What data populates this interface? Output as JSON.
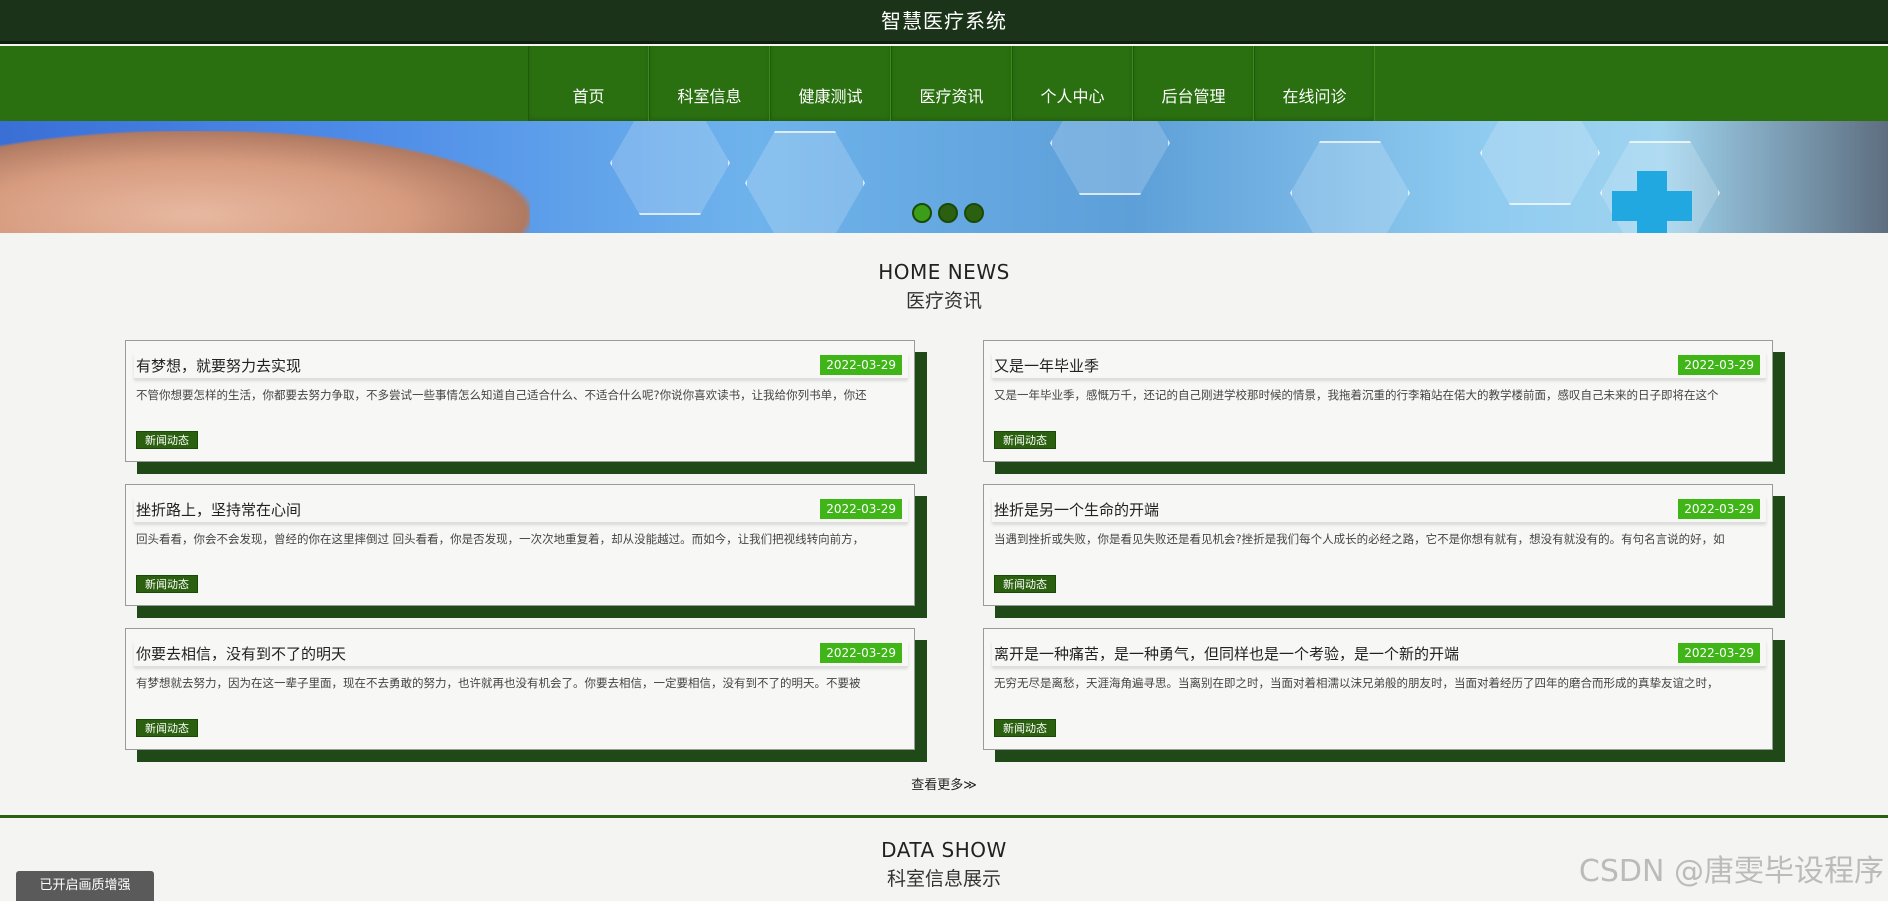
{
  "header": {
    "site_title": "智慧医疗系统"
  },
  "nav": {
    "items": [
      {
        "label": "首页"
      },
      {
        "label": "科室信息"
      },
      {
        "label": "健康测试"
      },
      {
        "label": "医疗资讯"
      },
      {
        "label": "个人中心"
      },
      {
        "label": "后台管理"
      },
      {
        "label": "在线问诊"
      }
    ]
  },
  "banner": {
    "slides_total": 3,
    "active_slide": 1
  },
  "news_section": {
    "heading_en": "HOME NEWS",
    "heading_zh": "医疗资讯",
    "items": [
      {
        "title": "有梦想，就要努力去实现",
        "date": "2022-03-29",
        "excerpt": "不管你想要怎样的生活，你都要去努力争取，不多尝试一些事情怎么知道自己适合什么、不适合什么呢?你说你喜欢读书，让我给你列书单，你还",
        "tag": "新闻动态"
      },
      {
        "title": "又是一年毕业季",
        "date": "2022-03-29",
        "excerpt": "又是一年毕业季，感慨万千，还记的自己刚进学校那时候的情景，我拖着沉重的行李箱站在偌大的教学楼前面，感叹自己未来的日子即将在这个",
        "tag": "新闻动态"
      },
      {
        "title": "挫折路上，坚持常在心间",
        "date": "2022-03-29",
        "excerpt": "回头看看，你会不会发现，曾经的你在这里摔倒过 回头看看，你是否发现，一次次地重复着，却从没能越过。而如今，让我们把视线转向前方，",
        "tag": "新闻动态"
      },
      {
        "title": "挫折是另一个生命的开端",
        "date": "2022-03-29",
        "excerpt": "当遇到挫折或失败，你是看见失败还是看见机会?挫折是我们每个人成长的必经之路，它不是你想有就有，想没有就没有的。有句名言说的好，如",
        "tag": "新闻动态"
      },
      {
        "title": "你要去相信，没有到不了的明天",
        "date": "2022-03-29",
        "excerpt": "有梦想就去努力，因为在这一辈子里面，现在不去勇敢的努力，也许就再也没有机会了。你要去相信，一定要相信，没有到不了的明天。不要被",
        "tag": "新闻动态"
      },
      {
        "title": "离开是一种痛苦，是一种勇气，但同样也是一个考验，是一个新的开端",
        "date": "2022-03-29",
        "excerpt": "无穷无尽是离愁，天涯海角遍寻思。当离别在即之时，当面对着相濡以沫兄弟般的朋友时，当面对着经历了四年的磨合而形成的真挚友谊之时，",
        "tag": "新闻动态"
      }
    ],
    "more_label": "查看更多≫"
  },
  "data_section": {
    "heading_en": "DATA SHOW",
    "heading_zh": "科室信息展示"
  },
  "overlay": {
    "toast": "已开启画质增强",
    "watermark": "CSDN @唐雯毕设程序"
  },
  "colors": {
    "top_bar": "#1b3419",
    "nav_bar": "#2a7010",
    "date_badge": "#3fb518",
    "card_shadow": "#1f4a17"
  }
}
